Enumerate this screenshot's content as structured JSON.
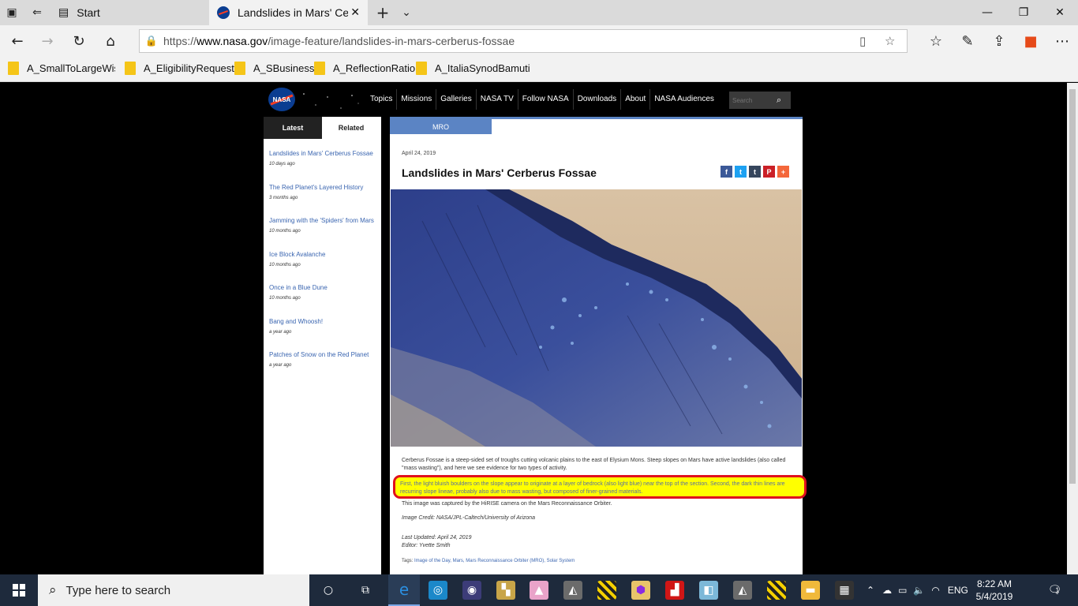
{
  "browser": {
    "tabs": [
      {
        "label": "Start"
      },
      {
        "label": "Landslides in Mars' Cerb"
      }
    ],
    "url_prefix": "https://",
    "url_host": "www.nasa.gov",
    "url_path": "/image-feature/landslides-in-mars-cerberus-fossae",
    "favorites": [
      "A_SmallToLargeWisdo",
      "A_EligibilityRequest",
      "A_SBusiness",
      "A_ReflectionRatio",
      "A_ItaliaSynodBamuti"
    ]
  },
  "site": {
    "logo_text": "NASA",
    "nav": [
      "Topics",
      "Missions",
      "Galleries",
      "NASA TV",
      "Follow NASA",
      "Downloads",
      "About",
      "NASA Audiences"
    ],
    "search_placeholder": "Search"
  },
  "sidebar": {
    "tabs": [
      "Latest",
      "Related"
    ],
    "items": [
      {
        "title": "Landslides in Mars' Cerberus Fossae",
        "date": "10 days ago"
      },
      {
        "title": "The Red Planet's Layered History",
        "date": "3 months ago"
      },
      {
        "title": "Jamming with the 'Spiders' from Mars",
        "date": "10 months ago"
      },
      {
        "title": "Ice Block Avalanche",
        "date": "10 months ago"
      },
      {
        "title": "Once in a Blue Dune",
        "date": "10 months ago"
      },
      {
        "title": "Bang and Whoosh!",
        "date": "a year ago"
      },
      {
        "title": "Patches of Snow on the Red Planet",
        "date": "a year ago"
      }
    ]
  },
  "article": {
    "category": "MRO",
    "date": "April 24, 2019",
    "title": "Landslides in Mars' Cerberus Fossae",
    "share": [
      "f",
      "t",
      "t",
      "P",
      "+"
    ],
    "p1": "Cerberus Fossae is a steep-sided set of troughs cutting volcanic plains to the east of Elysium Mons. Steep slopes on Mars have active landslides (also called \"mass wasting\"), and here we see evidence for two types of activity.",
    "p2": "First, the light bluish boulders on the slope appear to originate at a layer of bedrock (also light blue) near the top of the section. Second, the dark thin lines are recurring slope lineae, probably also due to mass wasting, but composed of finer-grained materials.",
    "p3": "This image was captured by the HiRISE camera on the Mars Reconnaissance Orbiter.",
    "credit": "Image Credit: NASA/JPL-Caltech/University of Arizona",
    "last_updated": "Last Updated: April 24, 2019",
    "editor": "Editor: Yvette Smith",
    "tags_label": "Tags:",
    "tags": "Image of the Day, Mars, Mars Reconnaissance Orbiter (MRO), Solar System"
  },
  "taskbar": {
    "search_placeholder": "Type here to search",
    "language": "ENG",
    "time": "8:22 AM",
    "date": "5/4/2019",
    "notifications": "1"
  },
  "colors": {
    "accent": "#5b84c4",
    "highlight": "#ffff00",
    "highlight_border": "#e0101e",
    "link": "#3a65b0"
  }
}
